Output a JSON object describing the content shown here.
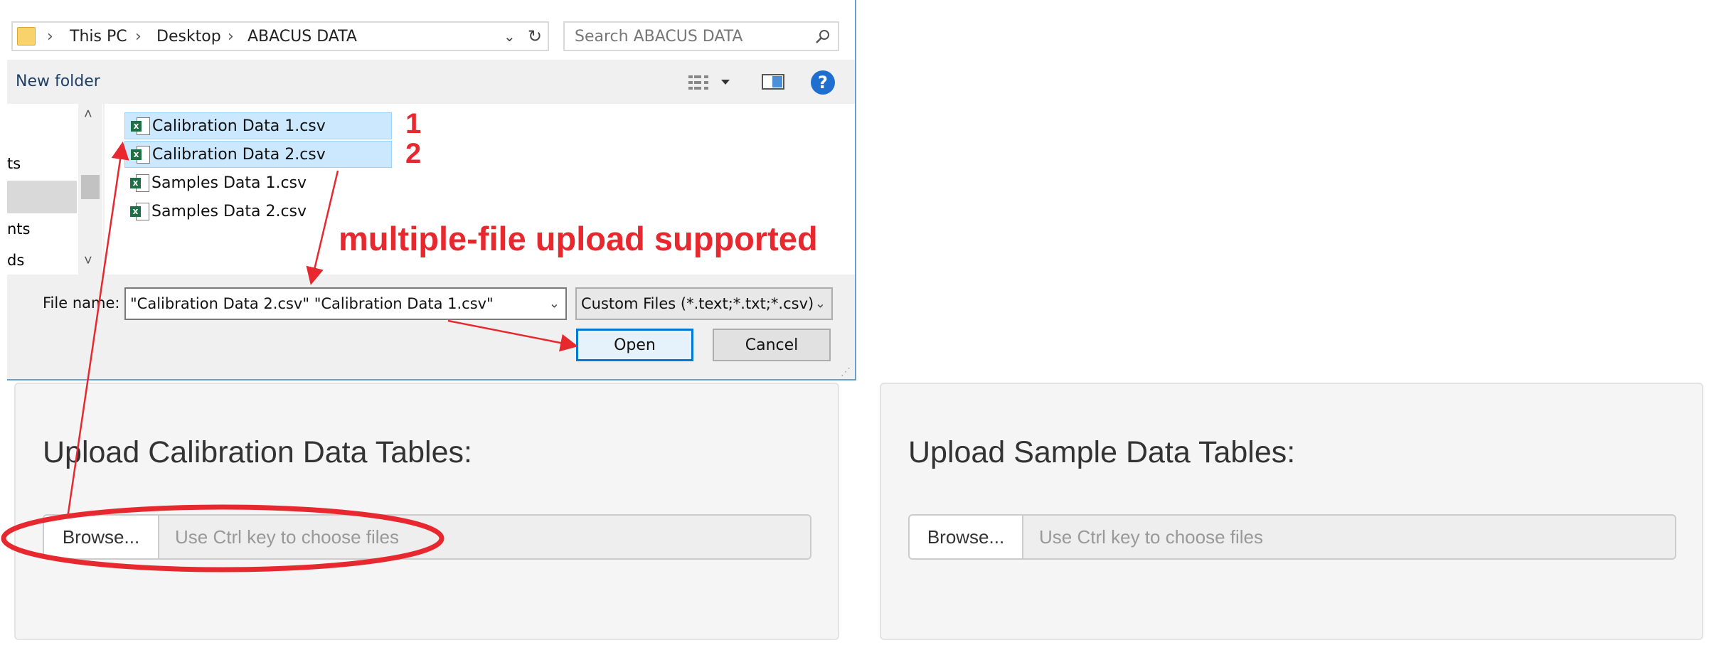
{
  "dialog": {
    "breadcrumb": [
      "This PC",
      "Desktop",
      "ABACUS DATA"
    ],
    "search_placeholder": "Search ABACUS DATA",
    "new_folder_label": "New folder",
    "nav_fragments": [
      "ts",
      "nts",
      "ds"
    ],
    "files": [
      {
        "name": "Calibration Data 1.csv",
        "selected": true
      },
      {
        "name": "Calibration Data 2.csv",
        "selected": true
      },
      {
        "name": "Samples Data 1.csv",
        "selected": false
      },
      {
        "name": "Samples Data 2.csv",
        "selected": false
      }
    ],
    "file_name_label": "File name:",
    "file_name_value": "\"Calibration Data 2.csv\" \"Calibration Data 1.csv\"",
    "file_type_value": "Custom Files (*.text;*.txt;*.csv)",
    "open_label": "Open",
    "cancel_label": "Cancel",
    "help_glyph": "?"
  },
  "annotations": {
    "num1": "1",
    "num2": "2",
    "note": "multiple-file upload supported",
    "color": "#e8282f"
  },
  "calibration_panel": {
    "title": "Upload Calibration Data Tables:",
    "browse_label": "Browse...",
    "placeholder": "Use Ctrl key to choose files"
  },
  "sample_panel": {
    "title": "Upload Sample Data Tables:",
    "browse_label": "Browse...",
    "placeholder": "Use Ctrl key to choose files"
  }
}
